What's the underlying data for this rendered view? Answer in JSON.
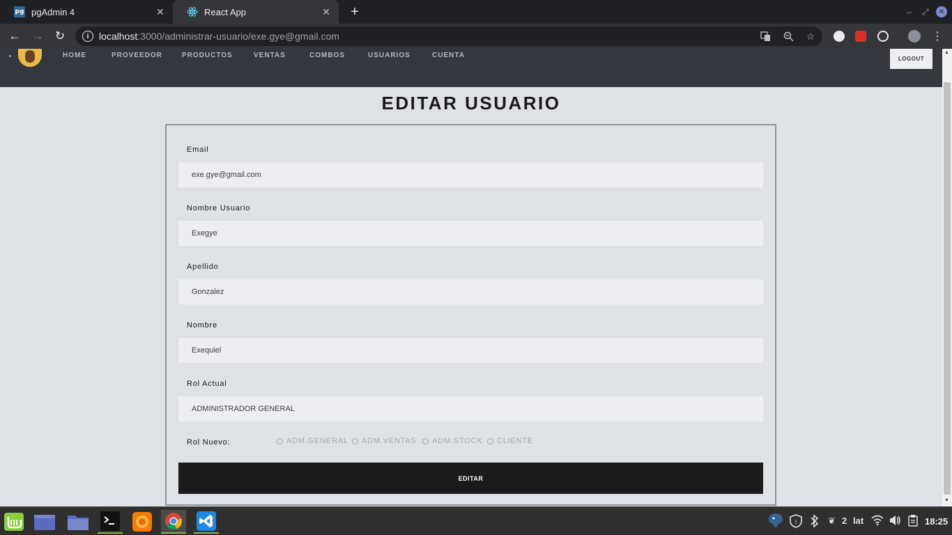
{
  "browser": {
    "tabs": [
      {
        "title": "pgAdmin 4",
        "icon": "pg"
      },
      {
        "title": "React App"
      }
    ],
    "url_host": "localhost",
    "url_path": ":3000/administrar-usuario/exe.gye@gmail.com"
  },
  "nav": {
    "items": [
      "HOME",
      "PROVEEDOR",
      "PRODUCTOS",
      "VENTAS",
      "COMBOS",
      "USUARIOS",
      "CUENTA"
    ],
    "logout": "LOGOUT"
  },
  "page": {
    "title": "EDITAR USUARIO"
  },
  "form": {
    "email_label": "Email",
    "email_value": "exe.gye@gmail.com",
    "nombre_usuario_label": "Nombre Usuario",
    "nombre_usuario_value": "Exegye",
    "apellido_label": "Apellido",
    "apellido_value": "Gonzalez",
    "nombre_label": "Nombre",
    "nombre_value": "Exequiel",
    "rol_actual_label": "Rol Actual",
    "rol_actual_value": "ADMINISTRADOR GENERAL",
    "rol_nuevo_label": "Rol Nuevo:",
    "roles": [
      "ADM.GENERAL",
      "ADM.VENTAS",
      "ADM.STOCK",
      "CLIENTE"
    ],
    "submit": "EDITAR"
  },
  "taskbar": {
    "workspace": "2",
    "keyboard": "lat",
    "clock": "18:25"
  },
  "colors": {
    "navbar_bg": "#35373e",
    "page_bg": "#dee1e6",
    "input_bg": "#eceef1",
    "button_bg": "#1b1b1b"
  }
}
